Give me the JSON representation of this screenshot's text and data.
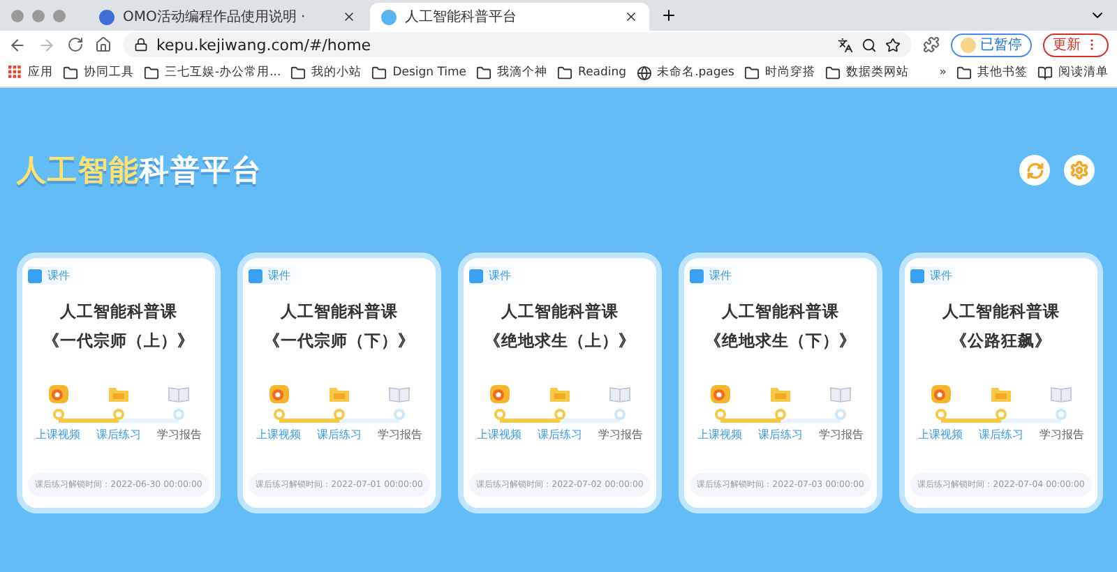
{
  "browser": {
    "tabs": [
      {
        "title": "OMO活动编程作品使用说明 ·",
        "selected": false
      },
      {
        "title": "人工智能科普平台",
        "selected": true
      }
    ],
    "address": "kepu.kejiwang.com/#/home",
    "paused_label": "已暂停",
    "update_label": "更新",
    "bookmarks": [
      {
        "kind": "apps",
        "label": "应用"
      },
      {
        "kind": "folder",
        "label": "协同工具"
      },
      {
        "kind": "folder",
        "label": "三七互娱-办公常用..."
      },
      {
        "kind": "folder",
        "label": "我的小站"
      },
      {
        "kind": "folder",
        "label": "Design Time"
      },
      {
        "kind": "folder",
        "label": "我滴个神"
      },
      {
        "kind": "folder",
        "label": "Reading"
      },
      {
        "kind": "globe",
        "label": "未命名.pages"
      },
      {
        "kind": "folder",
        "label": "时尚穿搭"
      },
      {
        "kind": "folder",
        "label": "数据类网站"
      }
    ],
    "more": "»",
    "other_bookmarks": [
      {
        "kind": "folder",
        "label": "其他书签"
      },
      {
        "kind": "list",
        "label": "阅读清单"
      }
    ]
  },
  "page": {
    "title_highlight": "人工智能",
    "title_rest": "科普平台",
    "cards": [
      {
        "tag": "课件",
        "title": "人工智能科普课",
        "subtitle": "《一代宗师（上）》",
        "unlock": "课后练习解锁时间：2022-06-30 00:00:00",
        "steps": [
          {
            "kind": "video",
            "label": "上课视频",
            "done": true
          },
          {
            "kind": "practice",
            "label": "课后练习",
            "done": true
          },
          {
            "kind": "report",
            "label": "学习报告",
            "done": false
          }
        ]
      },
      {
        "tag": "课件",
        "title": "人工智能科普课",
        "subtitle": "《一代宗师（下）》",
        "unlock": "课后练习解锁时间：2022-07-01 00:00:00",
        "steps": [
          {
            "kind": "video",
            "label": "上课视频",
            "done": true
          },
          {
            "kind": "practice",
            "label": "课后练习",
            "done": true
          },
          {
            "kind": "report",
            "label": "学习报告",
            "done": false
          }
        ]
      },
      {
        "tag": "课件",
        "title": "人工智能科普课",
        "subtitle": "《绝地求生（上）》",
        "unlock": "课后练习解锁时间：2022-07-02 00:00:00",
        "steps": [
          {
            "kind": "video",
            "label": "上课视频",
            "done": true
          },
          {
            "kind": "practice",
            "label": "课后练习",
            "done": true
          },
          {
            "kind": "report",
            "label": "学习报告",
            "done": false
          }
        ]
      },
      {
        "tag": "课件",
        "title": "人工智能科普课",
        "subtitle": "《绝地求生（下）》",
        "unlock": "课后练习解锁时间：2022-07-03 00:00:00",
        "steps": [
          {
            "kind": "video",
            "label": "上课视频",
            "done": true
          },
          {
            "kind": "practice",
            "label": "课后练习",
            "done": true
          },
          {
            "kind": "report",
            "label": "学习报告",
            "done": false
          }
        ]
      },
      {
        "tag": "课件",
        "title": "人工智能科普课",
        "subtitle": "《公路狂飙》",
        "unlock": "课后练习解锁时间：2022-07-04 00:00:00",
        "steps": [
          {
            "kind": "video",
            "label": "上课视频",
            "done": true
          },
          {
            "kind": "practice",
            "label": "课后练习",
            "done": true
          },
          {
            "kind": "report",
            "label": "学习报告",
            "done": false
          }
        ]
      }
    ]
  }
}
